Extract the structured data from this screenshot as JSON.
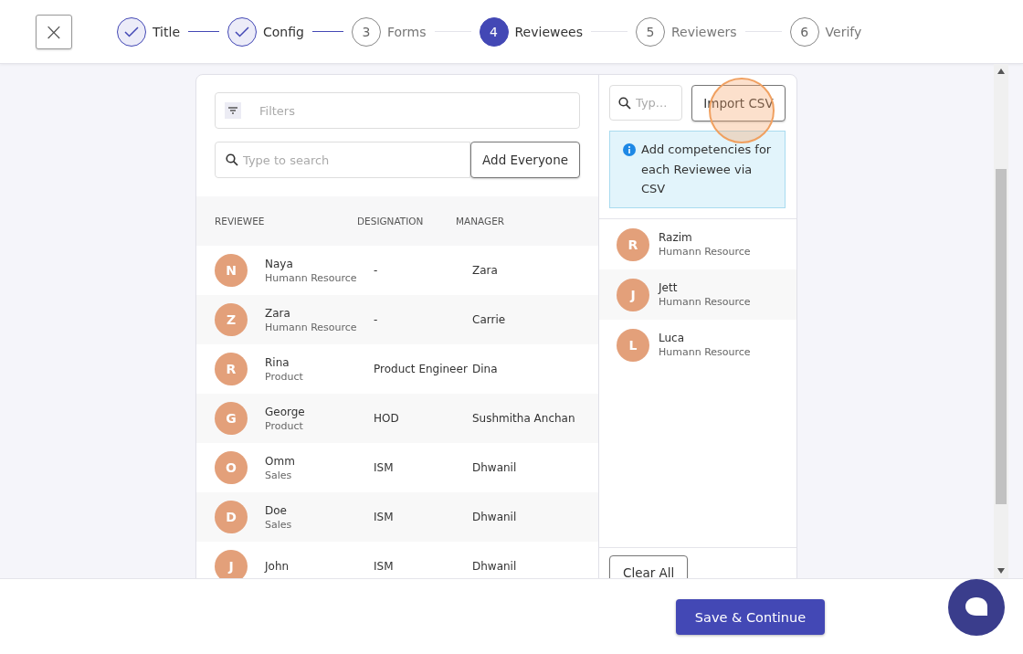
{
  "close_button": {
    "label": "×"
  },
  "steps": [
    {
      "label": "Title",
      "completed": true,
      "selected": false
    },
    {
      "label": "Config",
      "completed": true,
      "selected": false
    },
    {
      "number": "3",
      "label": "Forms",
      "completed": false,
      "selected": false
    },
    {
      "number": "4",
      "label": "Reviewees",
      "completed": false,
      "selected": true
    },
    {
      "number": "5",
      "label": "Reviewers",
      "completed": false,
      "selected": false
    },
    {
      "number": "6",
      "label": "Verify",
      "completed": false,
      "selected": false
    }
  ],
  "filters": {
    "placeholder": "Filters"
  },
  "search": {
    "placeholder": "Type to search"
  },
  "add_everyone_button": "Add Everyone",
  "table": {
    "columns": [
      "REVIEWEE",
      "DESIGNATION",
      "MANAGER"
    ],
    "rows": [
      {
        "initial": "N",
        "name": "Naya",
        "department": "Humann Resource",
        "designation": "-",
        "manager": "Zara"
      },
      {
        "initial": "Z",
        "name": "Zara",
        "department": "Humann Resource",
        "designation": "-",
        "manager": "Carrie"
      },
      {
        "initial": "R",
        "name": "Rina",
        "department": "Product",
        "designation": "Product Engineer",
        "manager": "Dina"
      },
      {
        "initial": "G",
        "name": "George",
        "department": "Product",
        "designation": "HOD",
        "manager": "Sushmitha Anchan"
      },
      {
        "initial": "O",
        "name": "Omm",
        "department": "Sales",
        "designation": "ISM",
        "manager": "Dhwanil"
      },
      {
        "initial": "D",
        "name": "Doe",
        "department": "Sales",
        "designation": "ISM",
        "manager": "Dhwanil"
      },
      {
        "initial": "J",
        "name": "John",
        "designation": "ISM",
        "manager": "Dhwanil"
      }
    ]
  },
  "selected_panel": {
    "search": {
      "placeholder": "Typ..."
    },
    "import_button": "Import CSV",
    "info": "Add competencies for each Reviewee via CSV",
    "items": [
      {
        "initial": "R",
        "name": "Razim",
        "department": "Humann Resource"
      },
      {
        "initial": "J",
        "name": "Jett",
        "department": "Humann Resource"
      },
      {
        "initial": "L",
        "name": "Luca",
        "department": "Humann Resource"
      }
    ],
    "clear_button": "Clear All"
  },
  "save_button": "Save & Continue"
}
